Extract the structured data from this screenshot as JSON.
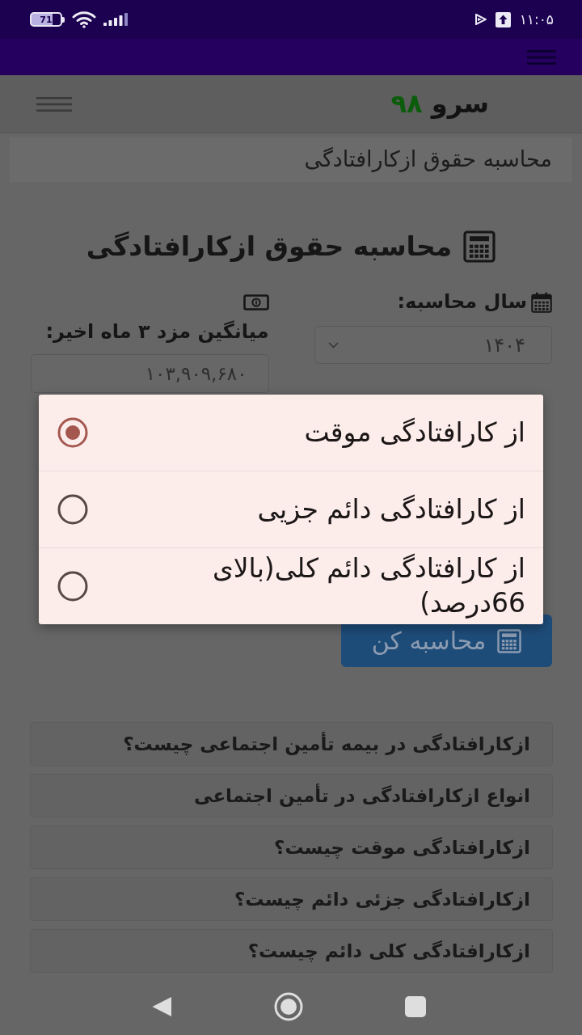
{
  "status_bar": {
    "battery": "71",
    "time": "۱۱:۰۵"
  },
  "navbar": {
    "brand": {
      "name": "سرو",
      "accent": "۹۸"
    }
  },
  "breadcrumb": [
    "محاسبه حقوق ازکارافتادگی"
  ],
  "page_title": "محاسبه حقوق ازکارافتادگی",
  "form": {
    "fields": [
      {
        "kind": "select",
        "label": "سال محاسبه:",
        "value": "۱۴۰۴"
      },
      {
        "kind": "input",
        "label": "میانگین مزد ۳ ماه اخیر:",
        "value": "۱۰۳,۹۰۹,۶۸۰"
      }
    ],
    "submit": "محاسبه کن"
  },
  "faq": [
    "ازکارافتادگی در بیمه تأمین اجتماعی چیست؟",
    "انواع ازکارافتادگی در تأمین اجتماعی",
    "ازکارافتادگی موقت چیست؟",
    "ازکارافتادگی جزئی دائم چیست؟",
    "ازکارافتادگی کلی دائم چیست؟"
  ],
  "options_dialog": {
    "options": [
      {
        "label": "از کارافتادگی موقت",
        "selected": true
      },
      {
        "label": "از کارافتادگی دائم جزیی",
        "selected": false
      },
      {
        "label": "از کارافتادگی دائم کلی(بالای 66درصد)",
        "selected": false
      }
    ]
  }
}
